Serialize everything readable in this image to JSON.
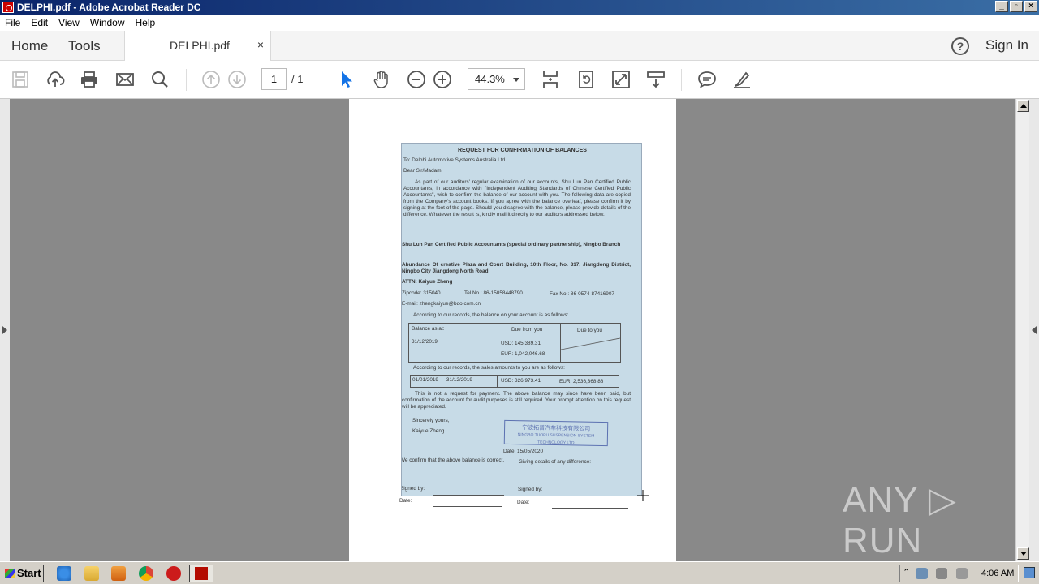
{
  "window": {
    "title": "DELPHI.pdf - Adobe Acrobat Reader DC",
    "min": "_",
    "max": "▫",
    "close": "×"
  },
  "menu": [
    "File",
    "Edit",
    "View",
    "Window",
    "Help"
  ],
  "tabs": {
    "home": "Home",
    "tools": "Tools",
    "doc": "DELPHI.pdf",
    "close": "×",
    "help": "?",
    "signin": "Sign In"
  },
  "toolbar": {
    "page_current": "1",
    "page_total": "/ 1",
    "zoom": "44.3%"
  },
  "document": {
    "title": "REQUEST FOR CONFIRMATION OF BALANCES",
    "to": "To: Delphi Automotive Systems Australia Ltd",
    "salutation": "Dear Sir/Madam,",
    "body": "As part of our auditors' regular examination of our accounts, Shu Lun Pan Certified Public Accountants, in accordance with \"Independent Auditing Standards of Chinese Certified Public Accountants\", wish to confirm the balance of our account with you. The following data are copied from the Company's account books. If you agree with the balance overleaf, please confirm it by signing at the foot of the page. Should you disagree with the balance, please provide details of the difference. Whatever the result is, kindly mail it directly to our auditors addressed below.",
    "firm": "Shu Lun Pan Certified Public Accountants (special ordinary partnership), Ningbo Branch",
    "address": "Abundance Of creative Plaza and Court Building, 10th Floor, No. 317, Jiangdong District, Ningbo City Jiangdong North Road",
    "attn": "ATTN: Kaiyue Zheng",
    "zipcode": "Zipcode: 315040",
    "tel": "Tel No.: 86-15058448790",
    "fax": "Fax No.: 86-0574-87416907",
    "email": "E-mail: zhengkaiyue@bdo.com.cn",
    "balance_intro": "According to our records, the balance on your account is as follows:",
    "balance_table": {
      "col1": "Balance as at:",
      "col2": "Due from you",
      "col3": "Due to you",
      "date": "31/12/2019",
      "usd": "USD: 145,389.31",
      "eur": "EUR: 1,042,046.68"
    },
    "sales_intro": "According to our records, the sales amounts to you are as follows:",
    "sales": {
      "period": "01/01/2019  —  31/12/2019",
      "usd": "USD: 326,973.41",
      "eur": "EUR: 2,536,368.88"
    },
    "note": "This is not a request for payment. The above balance may since have been paid, but confirmation of the account for audit purposes is still required. Your prompt attention on this request will be appreciated.",
    "closing": "Sincerely yours,",
    "signer": "Kaiyue Zheng",
    "stamp_line1": "宁波拓普汽车科技有限公司",
    "stamp_line2": "NINGBO TUOPU SUSPENSION SYSTEM TECHNOLOGY LTD",
    "date_line": "Date:    15/05/2020",
    "confirm_left": "We confirm that the above balance is correct.",
    "confirm_right": "Giving details of any difference:",
    "signed_by": "Signed by:",
    "date_label": "Date:"
  },
  "watermark": "ANY ▷ RUN",
  "taskbar": {
    "start": "Start",
    "clock": "4:06 AM"
  }
}
